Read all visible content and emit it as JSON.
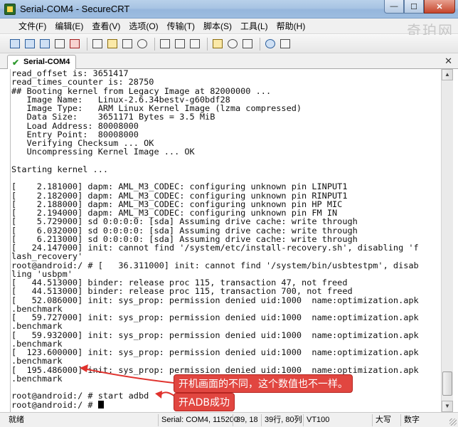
{
  "window": {
    "title": "Serial-COM4 - SecureCRT",
    "minimize": "—",
    "maximize": "☐",
    "close": "✕"
  },
  "menu": [
    "文件(F)",
    "编辑(E)",
    "查看(V)",
    "选项(O)",
    "传输(T)",
    "脚本(S)",
    "工具(L)",
    "帮助(H)"
  ],
  "watermark": "奇珀网",
  "watermark_logo": "760",
  "toolbar": {
    "icons": [
      "connect-icon",
      "quick-connect-icon",
      "connect-tab-icon",
      "reconnect-icon",
      "disconnect-icon",
      "copy-icon",
      "paste-icon",
      "copy-paste-icon",
      "find-icon",
      "print-icon",
      "print-selection-icon",
      "print-screen-icon",
      "session-options-icon",
      "global-options-icon",
      "keymap-icon",
      "help-icon",
      "sftp-icon"
    ]
  },
  "tab": {
    "label": "Serial-COM4",
    "close": "✕"
  },
  "terminal": {
    "lines": [
      "read_offset is: 3651417",
      "read_times_counter is: 28750",
      "## Booting kernel from Legacy Image at 82000000 ...",
      "   Image Name:   Linux-2.6.34bestv-g60bdf28",
      "   Image Type:   ARM Linux Kernel Image (lzma compressed)",
      "   Data Size:    3651171 Bytes = 3.5 MiB",
      "   Load Address: 80008000",
      "   Entry Point:  80008000",
      "   Verifying Checksum ... OK",
      "   Uncompressing Kernel Image ... OK",
      "",
      "Starting kernel ...",
      "",
      "[    2.181000] dapm: AML_M3_CODEC: configuring unknown pin LINPUT1",
      "[    2.182000] dapm: AML_M3_CODEC: configuring unknown pin RINPUT1",
      "[    2.188000] dapm: AML_M3_CODEC: configuring unknown pin HP MIC",
      "[    2.194000] dapm: AML_M3_CODEC: configuring unknown pin FM IN",
      "[    5.729000] sd 0:0:0:0: [sda] Assuming drive cache: write through",
      "[    6.032000] sd 0:0:0:0: [sda] Assuming drive cache: write through",
      "[    6.213000] sd 0:0:0:0: [sda] Assuming drive cache: write through",
      "[   24.147000] init: cannot find '/system/etc/install-recovery.sh', disabling 'f",
      "lash_recovery'",
      "root@android:/ # [   36.311000] init: cannot find '/system/bin/usbtestpm', disab",
      "ling 'usbpm'",
      "[   44.513000] binder: release proc 115, transaction 47, not freed",
      "[   44.513000] binder: release proc 115, transaction 700, not freed",
      "[   52.086000] init: sys_prop: permission denied uid:1000  name:optimization.apk",
      ".benchmark",
      "[   59.727000] init: sys_prop: permission denied uid:1000  name:optimization.apk",
      ".benchmark",
      "[   59.932000] init: sys_prop: permission denied uid:1000  name:optimization.apk",
      ".benchmark",
      "[  123.600000] init: sys_prop: permission denied uid:1000  name:optimization.apk",
      ".benchmark",
      "[  195.486000] init: sys_prop: permission denied uid:1000  name:optimization.apk",
      ".benchmark",
      "",
      "root@android:/ # start adbd",
      "root@android:/ # "
    ]
  },
  "annotations": {
    "note1": "开机画面的不同，这个数值也不一样。",
    "note2": "开ADB成功"
  },
  "status": {
    "ready": "就绪",
    "serial": "Serial: COM4, 115200",
    "cursor_pos": "39,  18",
    "rows_cols": "39行, 80列",
    "terminal": "VT100",
    "caps": "大写",
    "num": "数字"
  }
}
